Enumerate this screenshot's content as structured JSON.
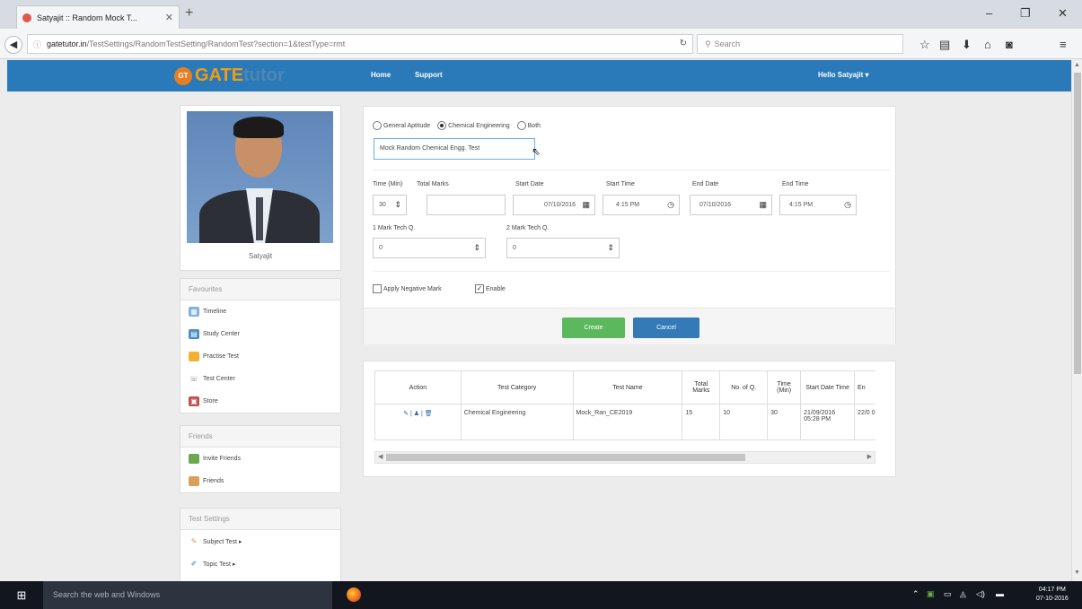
{
  "browser": {
    "tab_title": "Satyajit :: Random Mock T...",
    "tab_close": "✕",
    "new_tab": "+",
    "url_info": "ⓘ",
    "url_host": "gatetutor.in",
    "url_path": "/TestSettings/RandomTestSetting/RandomTest?section=1&testType=rmt",
    "search_placeholder": "Search",
    "win_minimize": "–",
    "win_maximize": "❐",
    "win_close": "✕"
  },
  "site": {
    "logo_badge": "GT",
    "logo_gate": "GATE",
    "logo_tutor": "tutor",
    "nav_home": "Home",
    "nav_support": "Support",
    "user_menu": "Hello Satyajit ▾"
  },
  "profile": {
    "name": "Satyajit"
  },
  "sidebar": {
    "favourites_title": "Favourites",
    "favourites": [
      "Timeline",
      "Study Center",
      "Practise Test",
      "Test Center",
      "Store"
    ],
    "friends_title": "Friends",
    "friends": [
      "Invite Friends",
      "Friends"
    ],
    "settings_title": "Test Settings",
    "settings": [
      "Subject Test ▸",
      "Topic Test ▸"
    ]
  },
  "form": {
    "radio_general": "General Aptitude",
    "radio_chemical": "Chemical Engineering",
    "radio_both": "Both",
    "test_name_value": "Mock Random Chemical Engg. Test",
    "time_label": "Time (Min)",
    "time_value": "30",
    "total_marks_label": "Total Marks",
    "total_marks_value": "",
    "start_date_label": "Start Date",
    "start_date_value": "07/10/2016",
    "start_time_label": "Start Time",
    "start_time_value": "4:15 PM",
    "end_date_label": "End Date",
    "end_date_value": "07/10/2016",
    "end_time_label": "End Time",
    "end_time_value": "4:15 PM",
    "one_mark_label": "1 Mark Tech Q.",
    "one_mark_value": "0",
    "two_mark_label": "2 Mark Tech Q.",
    "two_mark_value": "0",
    "negative_mark_label": "Apply Negative Mark",
    "enable_label": "Enable",
    "enable_checked": true,
    "create_label": "Create",
    "cancel_label": "Cancel"
  },
  "table": {
    "headers": [
      "Action",
      "Test Category",
      "Test Name",
      "Total Marks",
      "No. of Q.",
      "Time (Min)",
      "Start Date Time",
      "En"
    ],
    "rows": [
      {
        "action": "✎ | ♟ | 🗑",
        "category": "Chemical Engineering",
        "name": "Mock_Ran_CE2019",
        "total_marks": "15",
        "num_q": "10",
        "time": "30",
        "start": "21/09/2016 05:28 PM",
        "end": "22/0 05:2"
      }
    ]
  },
  "taskbar": {
    "search_text": "Search the web and Windows",
    "time": "04:17 PM",
    "date": "07-10-2016"
  },
  "colors": {
    "header_blue": "#2a7ab9",
    "create_green": "#5cb85c",
    "cancel_blue": "#337ab7",
    "logo_orange": "#f39c12"
  }
}
